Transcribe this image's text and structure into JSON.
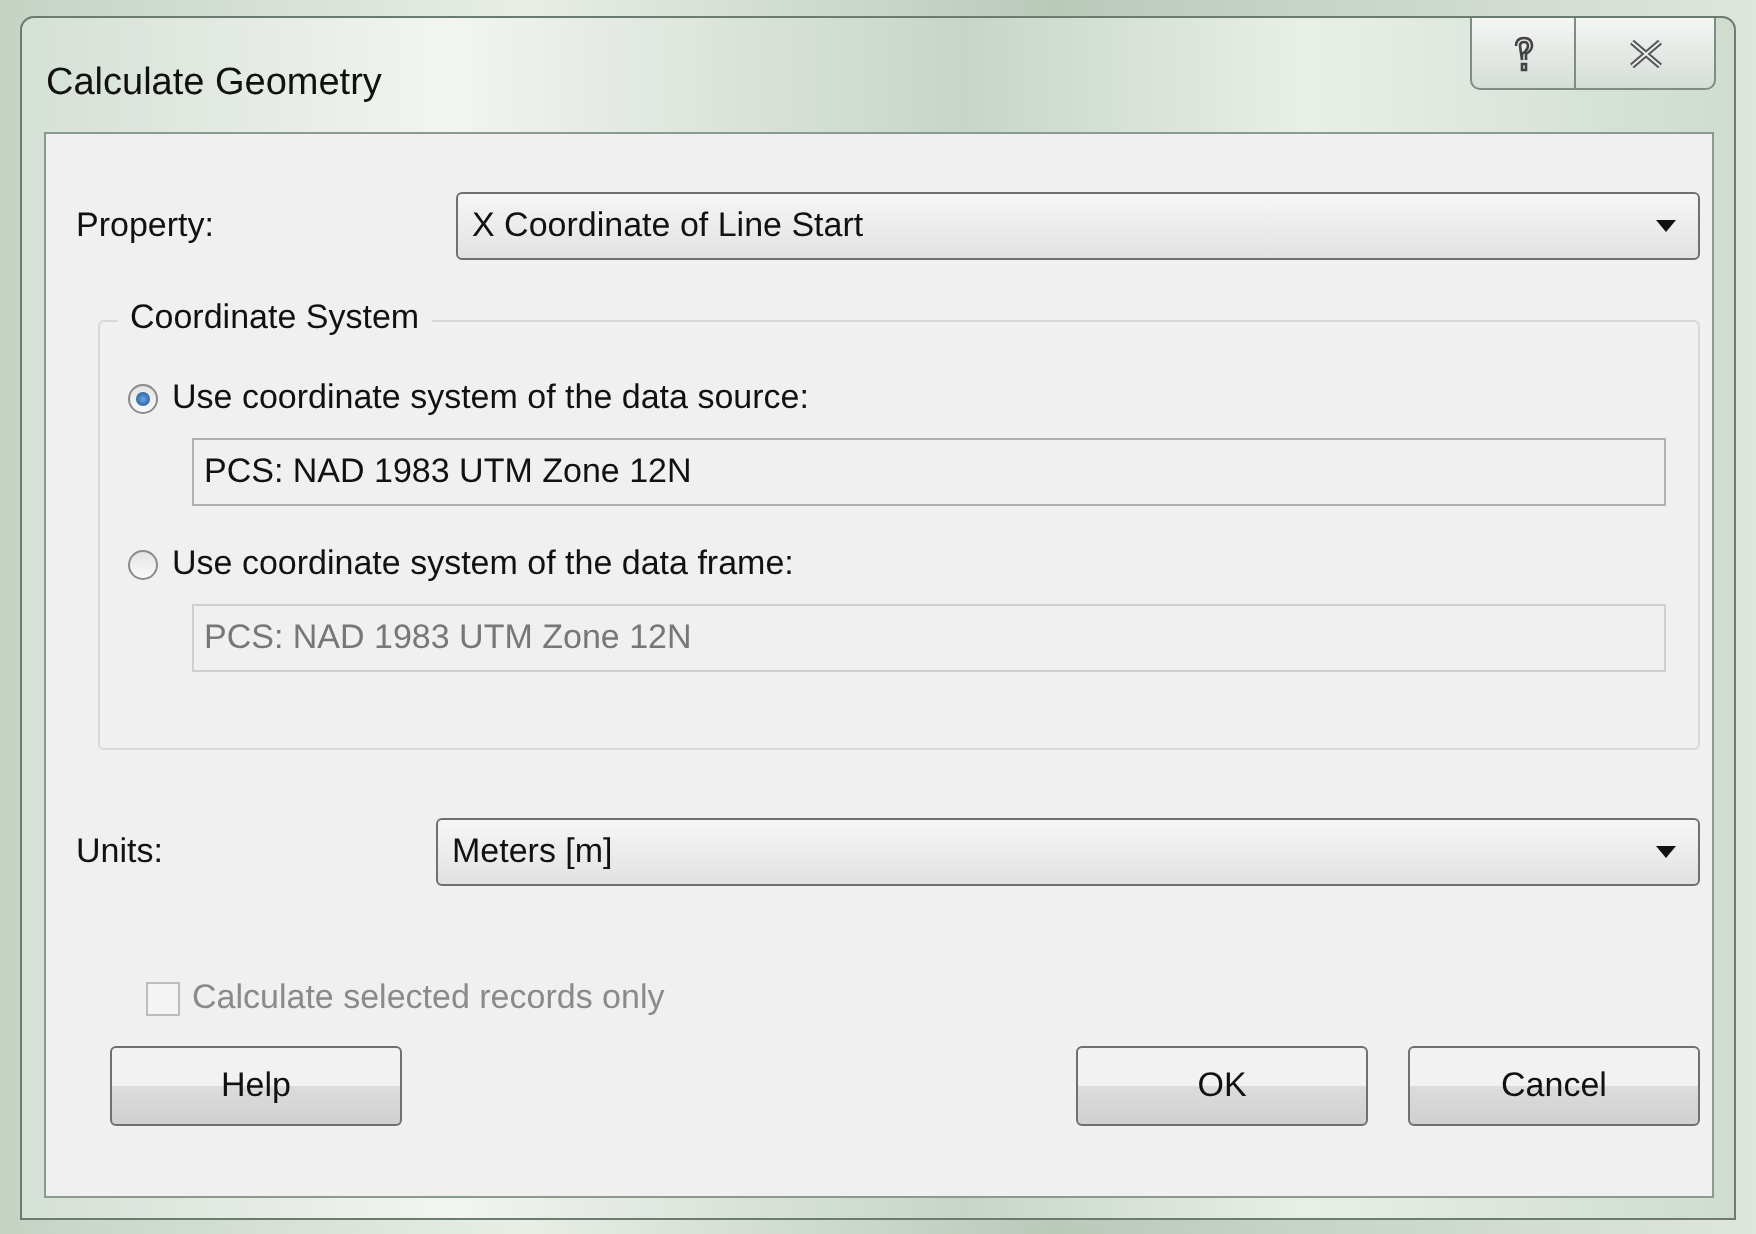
{
  "window": {
    "title": "Calculate Geometry"
  },
  "property": {
    "label": "Property:",
    "value": "X Coordinate of Line Start"
  },
  "coordinate_system": {
    "legend": "Coordinate System",
    "options": [
      {
        "label": "Use coordinate system of the data source:",
        "selected": true,
        "value": "PCS: NAD 1983 UTM Zone 12N",
        "disabled": false
      },
      {
        "label": "Use coordinate system of the data frame:",
        "selected": false,
        "value": "PCS: NAD 1983 UTM Zone 12N",
        "disabled": true
      }
    ]
  },
  "units": {
    "label": "Units:",
    "value": "Meters [m]"
  },
  "selected_only": {
    "label": "Calculate selected records only",
    "checked": false,
    "disabled": true
  },
  "buttons": [
    {
      "label": "Help",
      "kind": "left"
    },
    {
      "label": "OK",
      "kind": "right"
    },
    {
      "label": "Cancel",
      "kind": "right"
    }
  ]
}
